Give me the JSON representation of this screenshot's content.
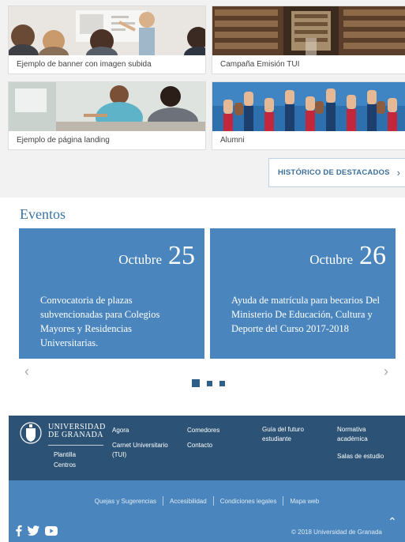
{
  "featured": {
    "cards": [
      {
        "caption": "Ejemplo de banner con imagen subida"
      },
      {
        "caption": "Campaña Emisión TUI"
      },
      {
        "caption": "Ejemplo de página landing"
      },
      {
        "caption": "Alumni"
      }
    ],
    "history_button": "HISTÓRICO DE DESTACADOS",
    "history_icon": "chevron-right-icon"
  },
  "events": {
    "title": "Eventos",
    "items": [
      {
        "month": "Octubre",
        "day": "25",
        "description": "Convocatoria de plazas subvencionadas para Colegios Mayores y Residencias Universitarias."
      },
      {
        "month": "Octubre",
        "day": "26",
        "description": "Ayuda de matrícula para becarios Del Ministerio De Educación, Cultura y Deporte del Curso 2017-2018"
      }
    ],
    "prev_arrow": "‹",
    "next_arrow": "›",
    "pager": {
      "pages": 3,
      "active": 1
    }
  },
  "footer": {
    "university_line1": "UNIVERSIDAD",
    "university_line2": "DE GRANADA",
    "links": {
      "plantilla": "Plantilla",
      "centros": "Centros",
      "agora": "Agora",
      "carnet_line1": "Carnet Universitario",
      "carnet_line2": "(TUI)",
      "comedores": "Comedores",
      "contacto": "Contacto",
      "guia_line1": "Guía del futuro",
      "guia_line2": "estudiante",
      "normativa_line1": "Normativa",
      "normativa_line2": "académica",
      "salas": "Salas de estudio"
    },
    "legal": [
      "Quejas y Sugerencias",
      "Accesibilidad",
      "Condiciones legales",
      "Mapa web"
    ],
    "copyright": "© 2018 Universidad de Granada",
    "social_icons": [
      "facebook-icon",
      "twitter-icon",
      "youtube-icon"
    ]
  },
  "colors": {
    "accent": "#4a86bd",
    "footer_dark": "#2c5375",
    "title_blue": "#3b73a2"
  }
}
